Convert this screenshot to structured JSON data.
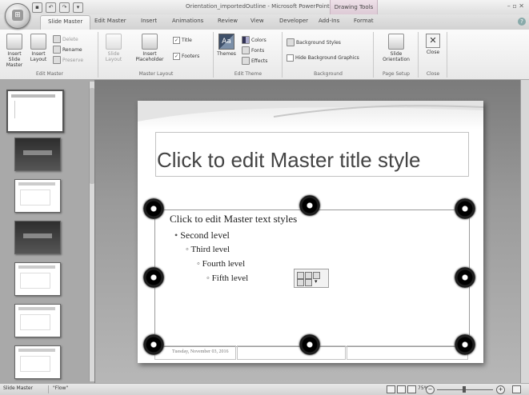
{
  "window": {
    "title": "Orientation_importedOutline - Microsoft PowerPoint",
    "context_tab": "Drawing Tools"
  },
  "quick_access": {
    "icons": [
      "save-icon",
      "undo-icon",
      "redo-icon",
      "customize-icon"
    ]
  },
  "ribbon_tabs": [
    "Slide Master",
    "Edit Master",
    "Insert",
    "Animations",
    "Review",
    "View",
    "Developer",
    "Add-Ins",
    "Format"
  ],
  "active_tab": "Slide Master",
  "ribbon": {
    "edit_master": {
      "label": "Edit Master",
      "insert_slide_master": "Insert Slide Master",
      "insert_layout": "Insert Layout",
      "delete": "Delete",
      "rename": "Rename",
      "preserve": "Preserve"
    },
    "master_layout": {
      "label": "Master Layout",
      "slide_layout": "Slide Layout",
      "insert_placeholder": "Insert Placeholder",
      "title": "Title",
      "footers": "Footers",
      "title_checked": true,
      "footers_checked": true
    },
    "edit_theme": {
      "label": "Edit Theme",
      "themes": "Themes",
      "colors": "Colors",
      "fonts": "Fonts",
      "effects": "Effects"
    },
    "background": {
      "label": "Background",
      "background_styles": "Background Styles",
      "hide_background_graphics": "Hide Background Graphics",
      "hide_checked": false
    },
    "page_setup": {
      "label": "Page Setup",
      "slide_orientation": "Slide Orientation"
    },
    "close": {
      "label": "Close",
      "close_btn": "Close"
    }
  },
  "slide": {
    "title": "Click to edit Master title style",
    "level1": "Click to edit Master text styles",
    "level2": "Second level",
    "level3": "Third level",
    "level4": "Fourth level",
    "level5": "Fifth level",
    "date": "Tuesday, November 03, 2016"
  },
  "thumbnails": [
    {
      "kind": "master",
      "selected": true
    },
    {
      "kind": "dark"
    },
    {
      "kind": "light"
    },
    {
      "kind": "dark"
    },
    {
      "kind": "light"
    },
    {
      "kind": "light"
    },
    {
      "kind": "light"
    }
  ],
  "status": {
    "view": "Slide Master",
    "theme": "\"Flow\"",
    "zoom": "75%"
  }
}
